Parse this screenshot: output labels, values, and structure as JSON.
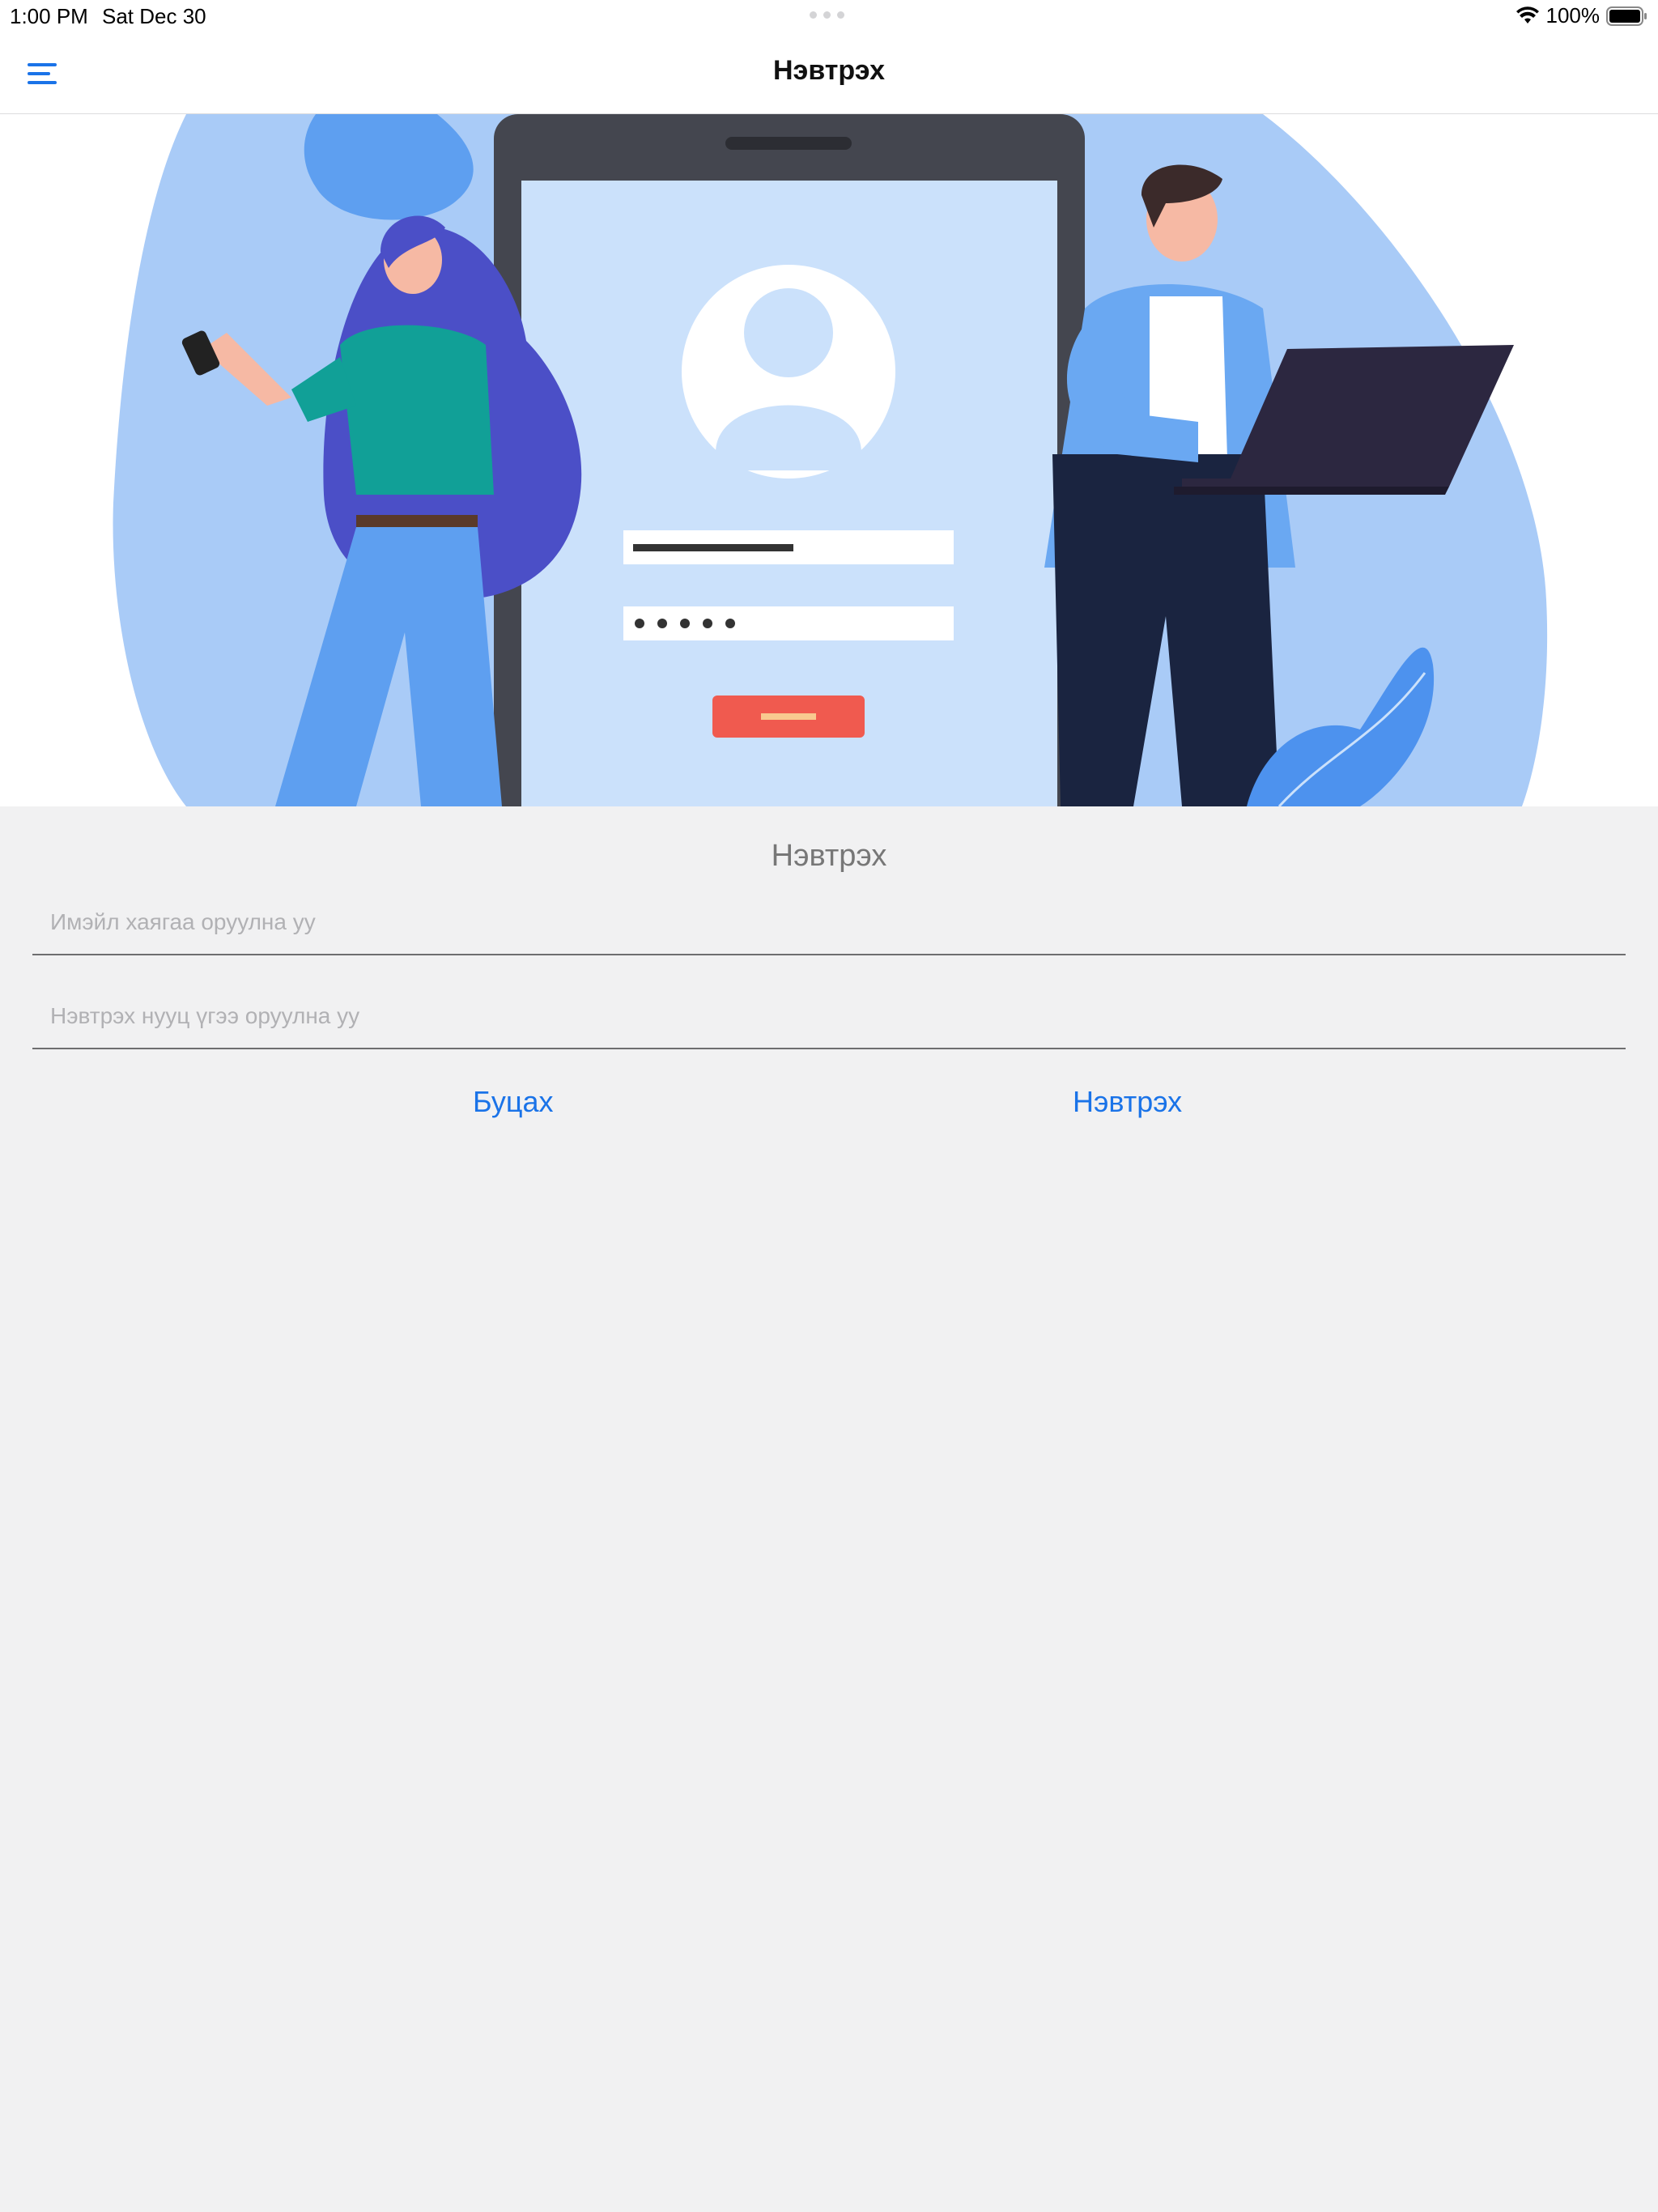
{
  "status_bar": {
    "time": "1:00 PM",
    "date": "Sat Dec 30",
    "battery": "100%"
  },
  "nav": {
    "title": "Нэвтрэх",
    "menu_icon": "hamburger-menu-icon"
  },
  "hero": {
    "illustration": "login-illustration"
  },
  "form": {
    "title": "Нэвтрэх",
    "email_placeholder": "Имэйл хаягаа оруулна уу",
    "email_value": "",
    "password_placeholder": "Нэвтрэх нууц үгээ оруулна уу",
    "password_value": "",
    "back_label": "Буцах",
    "login_label": "Нэвтрэх"
  },
  "colors": {
    "accent": "#1a73e8",
    "background": "#f1f1f2",
    "hero_blue": "#a9cbf7"
  }
}
